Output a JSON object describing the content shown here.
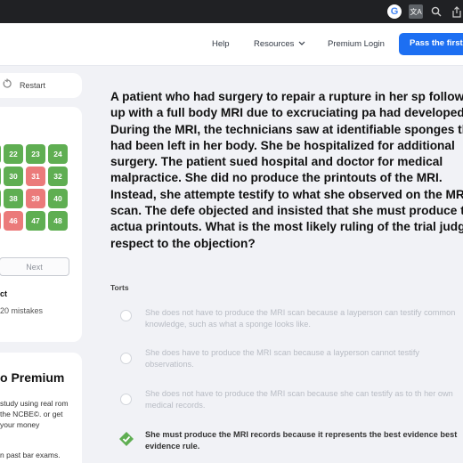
{
  "browser": {
    "google_icon": "google-icon",
    "translate_icon": "translate-icon",
    "zoom_icon": "zoom-icon",
    "share_icon": "share-icon"
  },
  "nav": {
    "help": "Help",
    "resources": "Resources",
    "premium_login": "Premium Login",
    "cta": "Pass the first t"
  },
  "sidebar": {
    "restart_label": "Restart",
    "tiles": [
      {
        "n": "22",
        "status": "correct"
      },
      {
        "n": "23",
        "status": "correct"
      },
      {
        "n": "24",
        "status": "correct"
      },
      {
        "n": "30",
        "status": "correct"
      },
      {
        "n": "31",
        "status": "incorrect"
      },
      {
        "n": "32",
        "status": "correct"
      },
      {
        "n": "38",
        "status": "correct"
      },
      {
        "n": "39",
        "status": "incorrect"
      },
      {
        "n": "40",
        "status": "correct"
      },
      {
        "n": "46",
        "status": "incorrect"
      },
      {
        "n": "47",
        "status": "correct"
      },
      {
        "n": "48",
        "status": "correct"
      }
    ],
    "next_label": "Next",
    "result_label": "ct",
    "result_sub": "20 mistakes",
    "premium_title": "o Premium",
    "premium_text": "study using real rom the NCBE©. or get your money",
    "premium_text2": "n past bar exams."
  },
  "question": {
    "text": "A patient who had surgery to repair a rupture in her sp followed up with a full body MRI due to excruciating pa had developed. During the MRI, the technicians saw at identifiable sponges that had been left in her body. She be hospitalized for additional surgery. The patient sued hospital and doctor for medical malpractice. She did no produce the printouts of the MRI. Instead, she attempte testify to what she observed on the MRI scan. The defe objected and insisted that she must produce the actua printouts. What is the most likely ruling of the trial judg respect to the objection?",
    "subject": "Torts",
    "options": [
      {
        "text": "She does not have to produce the MRI scan because a layperson can testify common knowledge, such as what a sponge looks like.",
        "state": "unselected"
      },
      {
        "text": "She does have to produce the MRI scan because a layperson cannot testify observations.",
        "state": "unselected"
      },
      {
        "text": "She does not have to produce the MRI scan because she can testify as to th her own medical records.",
        "state": "unselected"
      },
      {
        "text": "She must produce the MRI records because it represents the best evidence best evidence rule.",
        "state": "correct"
      }
    ]
  },
  "colors": {
    "accent": "#1d6ff2",
    "correct": "#5fae52",
    "incorrect": "#eb7a7a"
  }
}
